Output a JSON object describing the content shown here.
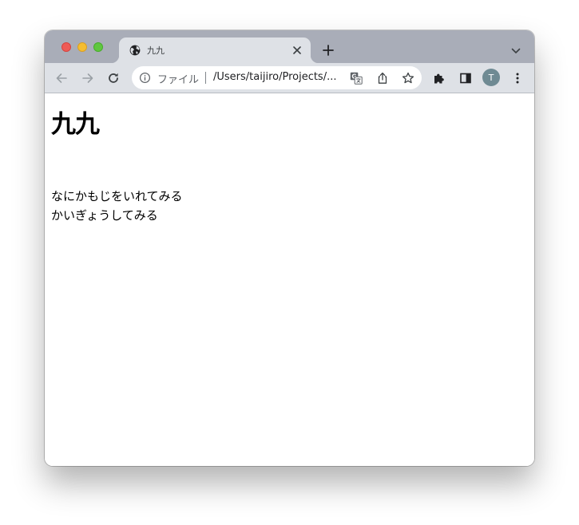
{
  "browser": {
    "tab": {
      "title": "九九"
    },
    "address_bar": {
      "scheme_label": "ファイル",
      "url": "/Users/taijiro/Projects/..."
    },
    "profile": {
      "initial": "T",
      "color": "#6f8a93"
    }
  },
  "page": {
    "heading": "九九",
    "lines": [
      "なにかもじをいれてみる",
      "かいぎょうしてみる"
    ]
  },
  "colors": {
    "titlebar": "#a9adb8",
    "toolbar": "#dee1e6",
    "close_light": "#ee5b56",
    "minimize_light": "#f5bd2f",
    "zoom_light": "#5fc73f"
  },
  "icons": [
    "globe-icon",
    "close-icon",
    "plus-icon",
    "chevron-down-icon",
    "back-arrow-icon",
    "forward-arrow-icon",
    "reload-icon",
    "info-icon",
    "translate-icon",
    "share-icon",
    "star-icon",
    "puzzle-icon",
    "side-panel-icon",
    "kebab-menu-icon"
  ]
}
